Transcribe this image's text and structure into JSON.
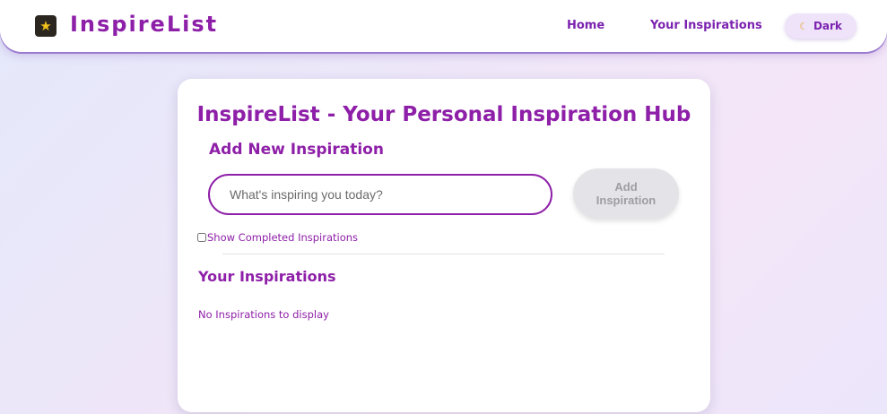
{
  "navbar": {
    "logo_icon": "star-icon",
    "brand": "InspireList",
    "links": [
      {
        "label": "Home"
      },
      {
        "label": "Your Inspirations"
      }
    ],
    "theme_toggle": {
      "icon": "moon-icon",
      "label": "Dark"
    }
  },
  "main": {
    "title": "InspireList - Your Personal Inspiration Hub",
    "add_section": {
      "heading": "Add New Inspiration",
      "input_placeholder": "What's inspiring you today?",
      "input_value": "",
      "add_button": "Add Inspiration"
    },
    "filter": {
      "label": "Show Completed Inspirations",
      "checked": false
    },
    "list_section": {
      "heading": "Your Inspirations",
      "empty_message": "No Inspirations to display"
    }
  },
  "colors": {
    "accent": "#8e1fa8",
    "nav_link": "#7b22b0",
    "disabled_button_bg": "#e4e4e8",
    "disabled_button_text": "#9d9da2"
  }
}
